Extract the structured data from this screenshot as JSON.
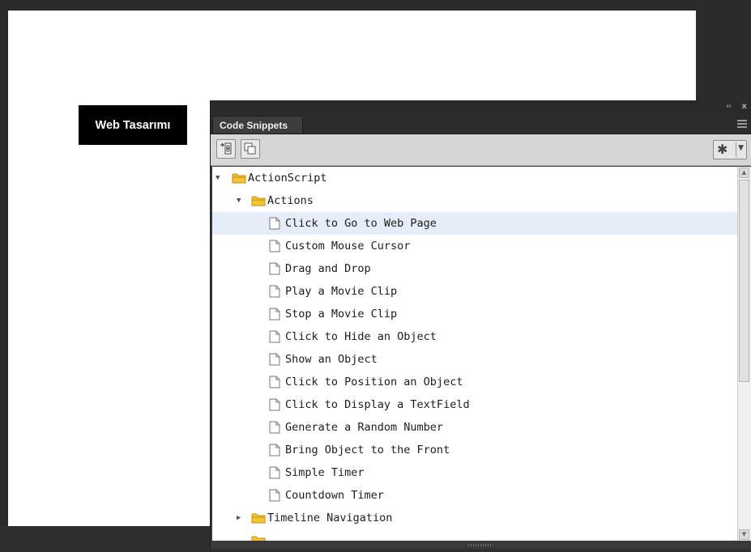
{
  "stage": {
    "button_label": "Web Tasarımı"
  },
  "panel": {
    "tab_title": "Code Snippets",
    "collapse_glyph": "‹‹",
    "close_glyph": "x"
  },
  "toolbar": {
    "add_to_frame_icon": "add-to-frame-icon",
    "copy_to_clipboard_icon": "copy-to-clipboard-icon",
    "options_icon": "gear-icon"
  },
  "tree": {
    "root": {
      "label": "ActionScript",
      "expanded": true
    },
    "actions": {
      "label": "Actions",
      "expanded": true,
      "items": [
        "Click to Go to Web Page",
        "Custom Mouse Cursor",
        "Drag and Drop",
        "Play a Movie Clip",
        "Stop a Movie Clip",
        "Click to Hide an Object",
        "Show an Object",
        "Click to Position an Object",
        "Click to Display a TextField",
        "Generate a Random Number",
        "Bring Object to the Front",
        "Simple Timer",
        "Countdown Timer"
      ],
      "selected_index": 0
    },
    "timeline": {
      "label": "Timeline Navigation",
      "expanded": false
    }
  },
  "colors": {
    "selection": "#e6ecf8",
    "panel_dark": "#3a3a3a",
    "folder_yellow": "#f5c431"
  }
}
